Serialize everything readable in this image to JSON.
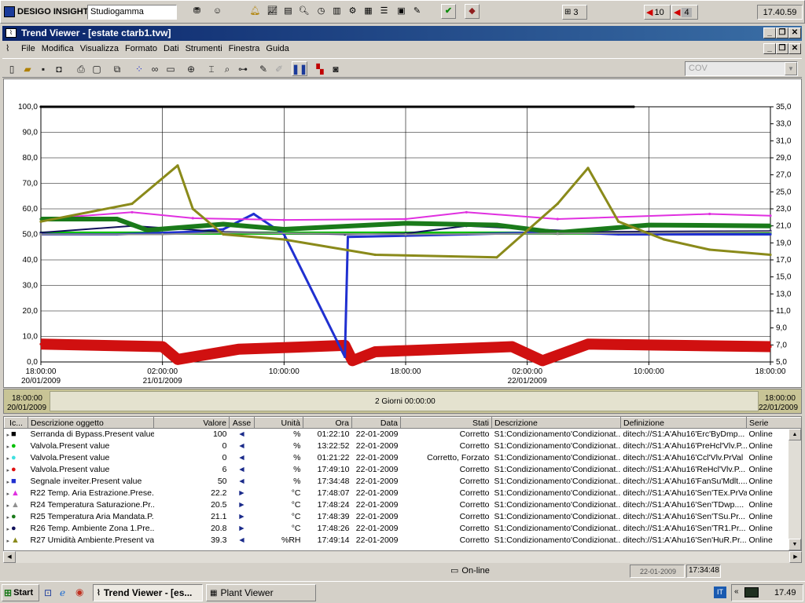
{
  "topbar": {
    "brand": "DESIGO INSIGHT",
    "site": "Studiogamma",
    "count1": "3",
    "alarm1": "10",
    "alarm2": "4",
    "clock": "17.40.59"
  },
  "window": {
    "title": "Trend Viewer - [estate ctarb1.tvw]",
    "menu": [
      "File",
      "Modifica",
      "Visualizza",
      "Formato",
      "Dati",
      "Strumenti",
      "Finestra",
      "Guida"
    ],
    "combo": "COV"
  },
  "chart_data": {
    "type": "line",
    "x_ticks": [
      {
        "time": "18:00:00",
        "date": "20/01/2009"
      },
      {
        "time": "02:00:00",
        "date": "21/01/2009"
      },
      {
        "time": "10:00:00",
        "date": ""
      },
      {
        "time": "18:00:00",
        "date": ""
      },
      {
        "time": "02:00:00",
        "date": "22/01/2009"
      },
      {
        "time": "10:00:00",
        "date": ""
      },
      {
        "time": "18:00:00",
        "date": ""
      }
    ],
    "y_left": {
      "ticks": [
        "100,0",
        "90,0",
        "80,0",
        "70,0",
        "60,0",
        "50,0",
        "40,0",
        "30,0",
        "20,0",
        "10,0",
        "0,0"
      ],
      "range": [
        0,
        100
      ]
    },
    "y_right": {
      "ticks": [
        "35,0",
        "33,0",
        "31,0",
        "29,0",
        "27,0",
        "25,0",
        "23,0",
        "21,0",
        "19,0",
        "17,0",
        "15,0",
        "13,0",
        "11,0",
        "9,0",
        "7,0",
        "5,0"
      ],
      "range": [
        5,
        35
      ]
    },
    "x_range_hours": [
      0,
      48
    ],
    "grid": true,
    "series": [
      {
        "color": "#000000",
        "axis": "left",
        "points": [
          [
            0,
            100
          ],
          [
            39,
            100
          ]
        ]
      },
      {
        "color": "#00c000",
        "axis": "left",
        "points": [
          [
            0,
            50.5
          ],
          [
            24,
            50.5
          ],
          [
            48,
            50.5
          ]
        ]
      },
      {
        "color": "#d01010",
        "axis": "left",
        "points": [
          [
            0,
            7
          ],
          [
            8,
            6
          ],
          [
            9,
            1
          ],
          [
            13,
            5
          ],
          [
            20,
            6.5
          ],
          [
            20.5,
            0.5
          ],
          [
            22,
            4
          ],
          [
            31,
            6
          ],
          [
            33,
            0.5
          ],
          [
            36,
            7
          ],
          [
            48,
            6
          ]
        ]
      },
      {
        "color": "#2030d0",
        "axis": "left",
        "points": [
          [
            0,
            50
          ],
          [
            5,
            50
          ],
          [
            10,
            51
          ],
          [
            12,
            52
          ],
          [
            14,
            58
          ],
          [
            16,
            50
          ],
          [
            20,
            2
          ],
          [
            20.2,
            49
          ],
          [
            28,
            50
          ],
          [
            34,
            51
          ],
          [
            38,
            50
          ],
          [
            48,
            50
          ]
        ]
      },
      {
        "color": "#e030e0",
        "axis": "right",
        "points": [
          [
            0,
            21.8
          ],
          [
            6,
            22.6
          ],
          [
            10,
            21.9
          ],
          [
            16,
            21.7
          ],
          [
            24,
            21.8
          ],
          [
            28,
            22.6
          ],
          [
            34,
            21.8
          ],
          [
            44,
            22.4
          ],
          [
            48,
            22.2
          ]
        ]
      },
      {
        "color": "#10105a",
        "axis": "right",
        "points": [
          [
            0,
            20.2
          ],
          [
            6,
            21
          ],
          [
            12,
            20.3
          ],
          [
            20,
            20
          ],
          [
            24,
            20.1
          ],
          [
            28,
            21
          ],
          [
            36,
            20.3
          ],
          [
            48,
            20.4
          ]
        ]
      },
      {
        "color": "#1a7a1a",
        "axis": "right",
        "points": [
          [
            0,
            21.8
          ],
          [
            5,
            21.8
          ],
          [
            7,
            20.5
          ],
          [
            12,
            21.2
          ],
          [
            16,
            20.6
          ],
          [
            24,
            21.3
          ],
          [
            30,
            21.1
          ],
          [
            34,
            20.2
          ],
          [
            40,
            21.1
          ],
          [
            48,
            21
          ]
        ]
      },
      {
        "color": "#909090",
        "axis": "right",
        "points": [
          [
            0,
            20
          ],
          [
            8,
            20
          ],
          [
            12,
            20.2
          ],
          [
            24,
            20
          ],
          [
            34,
            20.1
          ],
          [
            48,
            20.3
          ]
        ]
      },
      {
        "color": "#8a8a1a",
        "axis": "left",
        "points": [
          [
            0,
            55
          ],
          [
            6,
            62
          ],
          [
            9,
            77
          ],
          [
            10,
            60
          ],
          [
            12,
            50
          ],
          [
            16,
            48
          ],
          [
            22,
            42
          ],
          [
            30,
            41
          ],
          [
            34,
            62
          ],
          [
            36,
            76
          ],
          [
            38,
            55
          ],
          [
            41,
            48
          ],
          [
            44,
            44
          ],
          [
            48,
            42
          ]
        ]
      }
    ]
  },
  "range": {
    "left_time": "18:00:00",
    "left_date": "20/01/2009",
    "center": "2 Giorni 00:00:00",
    "right_time": "18:00:00",
    "right_date": "22/01/2009"
  },
  "grid": {
    "headers": [
      "Ic...",
      "Descrizione oggetto",
      "Valore",
      "Asse",
      "Unità",
      "Ora",
      "Data",
      "Stati",
      "Descrizione",
      "Definizione",
      "Serie"
    ],
    "rows": [
      {
        "marker": "■",
        "mcolor": "#000000",
        "desc": "Serranda di Bypass.Present value",
        "val": "100",
        "axis": "◄",
        "unit": "%",
        "time": "01:22:10",
        "date": "22-01-2009",
        "state": "Corretto",
        "descr": "S1:Condizionamento'Condizionat...",
        "def": "ditech://S1:A'Ahu16'Erc'ByDmp...",
        "serie": "Online"
      },
      {
        "marker": "●",
        "mcolor": "#00c000",
        "desc": "Valvola.Present value",
        "val": "0",
        "axis": "◄",
        "unit": "%",
        "time": "13:22:52",
        "date": "22-01-2009",
        "state": "Corretto",
        "descr": "S1:Condizionamento'Condizionat...",
        "def": "ditech://S1:A'Ahu16'PreHcl'Vlv.P...",
        "serie": "Online"
      },
      {
        "marker": "●",
        "mcolor": "#40e0e0",
        "desc": "Valvola.Present value",
        "val": "0",
        "axis": "◄",
        "unit": "%",
        "time": "01:21:22",
        "date": "22-01-2009",
        "state": "Corretto, Forzato",
        "descr": "S1:Condizionamento'Condizionat...",
        "def": "ditech://S1:A'Ahu16'Ccl'Vlv.PrVal",
        "serie": "Online"
      },
      {
        "marker": "●",
        "mcolor": "#e01010",
        "desc": "Valvola.Present value",
        "val": "6",
        "axis": "◄",
        "unit": "%",
        "time": "17:49:10",
        "date": "22-01-2009",
        "state": "Corretto",
        "descr": "S1:Condizionamento'Condizionat...",
        "def": "ditech://S1:A'Ahu16'ReHcl'Vlv.P...",
        "serie": "Online"
      },
      {
        "marker": "■",
        "mcolor": "#2030d0",
        "desc": "Segnale inveiter.Present value",
        "val": "50",
        "axis": "◄",
        "unit": "%",
        "time": "17:34:48",
        "date": "22-01-2009",
        "state": "Corretto",
        "descr": "S1:Condizionamento'Condizionat...",
        "def": "ditech://S1:A'Ahu16'FanSu'Mdlt....",
        "serie": "Online"
      },
      {
        "marker": "▲",
        "mcolor": "#e030e0",
        "desc": "R22 Temp. Aria Estrazione.Prese...",
        "val": "22.2",
        "axis": "►",
        "unit": "°C",
        "time": "17:48:07",
        "date": "22-01-2009",
        "state": "Corretto",
        "descr": "S1:Condizionamento'Condizionat...",
        "def": "ditech://S1:A'Ahu16'Sen'TEx.PrVal",
        "serie": "Online"
      },
      {
        "marker": "▲",
        "mcolor": "#909090",
        "desc": "R24 Temperatura Saturazione.Pr...",
        "val": "20.5",
        "axis": "►",
        "unit": "°C",
        "time": "17:48:24",
        "date": "22-01-2009",
        "state": "Corretto",
        "descr": "S1:Condizionamento'Condizionat...",
        "def": "ditech://S1:A'Ahu16'Sen'TDwp....",
        "serie": "Online"
      },
      {
        "marker": "●",
        "mcolor": "#1a7a1a",
        "desc": "R25 Temperatura Aria Mandata.P...",
        "val": "21.1",
        "axis": "►",
        "unit": "°C",
        "time": "17:48:39",
        "date": "22-01-2009",
        "state": "Corretto",
        "descr": "S1:Condizionamento'Condizionat...",
        "def": "ditech://S1:A'Ahu16'Sen'TSu.Pr...",
        "serie": "Online"
      },
      {
        "marker": "●",
        "mcolor": "#10105a",
        "desc": "R26 Temp. Ambiente Zona 1.Pre...",
        "val": "20.8",
        "axis": "►",
        "unit": "°C",
        "time": "17:48:26",
        "date": "22-01-2009",
        "state": "Corretto",
        "descr": "S1:Condizionamento'Condizionat...",
        "def": "ditech://S1:A'Ahu16'Sen'TR1.Pr...",
        "serie": "Online"
      },
      {
        "marker": "▲",
        "mcolor": "#8a8a1a",
        "desc": "R27 Umidità Ambiente.Present va...",
        "val": "39.3",
        "axis": "◄",
        "unit": "%RH",
        "time": "17:49:14",
        "date": "22-01-2009",
        "state": "Corretto",
        "descr": "S1:Condizionamento'Condizionat...",
        "def": "ditech://S1:A'Ahu16'Sen'HuR.Pr...",
        "serie": "Online"
      }
    ]
  },
  "status": {
    "online": "On-line",
    "date_hint": "22-01-2009",
    "time_hint": "17:34:48"
  },
  "taskbar": {
    "start": "Start",
    "task1": "Trend Viewer - [es...",
    "task2": "Plant Viewer",
    "lang": "IT",
    "clock": "17.49"
  }
}
